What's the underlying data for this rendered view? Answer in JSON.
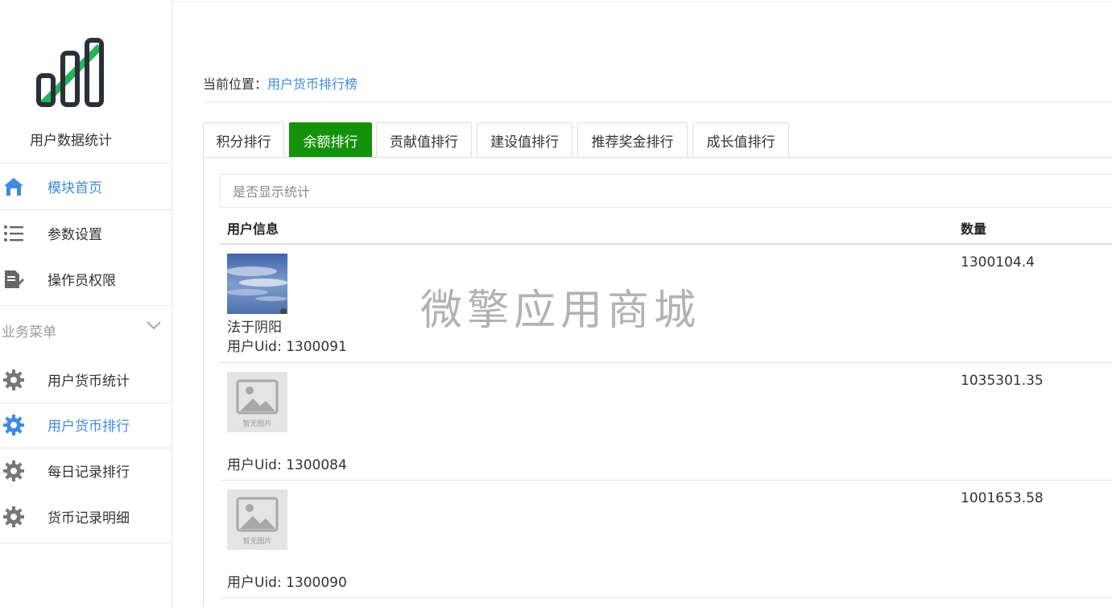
{
  "sidebar": {
    "app_title": "用户数据统计",
    "items": [
      {
        "label": "模块首页",
        "icon": "home-icon",
        "active": true
      },
      {
        "label": "参数设置",
        "icon": "list-icon",
        "active": false
      },
      {
        "label": "操作员权限",
        "icon": "edit-document-icon",
        "active": false
      }
    ],
    "group_title": "业务菜单",
    "group_items": [
      {
        "label": "用户货币统计",
        "icon": "gear-icon",
        "active": false
      },
      {
        "label": "用户货币排行",
        "icon": "gear-icon",
        "active": true
      },
      {
        "label": "每日记录排行",
        "icon": "gear-icon",
        "active": false
      },
      {
        "label": "货币记录明细",
        "icon": "gear-icon",
        "active": false
      }
    ]
  },
  "breadcrumb": {
    "prefix": "当前位置：",
    "current": "用户货币排行榜"
  },
  "tabs": [
    {
      "label": "积分排行",
      "active": false
    },
    {
      "label": "余额排行",
      "active": true
    },
    {
      "label": "贡献值排行",
      "active": false
    },
    {
      "label": "建设值排行",
      "active": false
    },
    {
      "label": "推荐奖金排行",
      "active": false
    },
    {
      "label": "成长值排行",
      "active": false
    }
  ],
  "stat_toggle": "是否显示统计",
  "table": {
    "headers": [
      "用户信息",
      "数量"
    ],
    "rows": [
      {
        "name": "法于阴阳",
        "uid": "用户Uid: 1300091",
        "amount": "1300104.4",
        "avatar": "sky-photo"
      },
      {
        "name": "",
        "uid": "用户Uid: 1300084",
        "amount": "1035301.35",
        "avatar": "no-image",
        "no_image_text": "暂无图片"
      },
      {
        "name": "",
        "uid": "用户Uid: 1300090",
        "amount": "1001653.58",
        "avatar": "no-image",
        "no_image_text": "暂无图片"
      }
    ]
  },
  "watermark": "微擎应用商城",
  "colors": {
    "accent": "#3d8be0",
    "active_tab": "#15920c",
    "logo_green": "#22b35e",
    "logo_dark": "#2b2f38"
  }
}
